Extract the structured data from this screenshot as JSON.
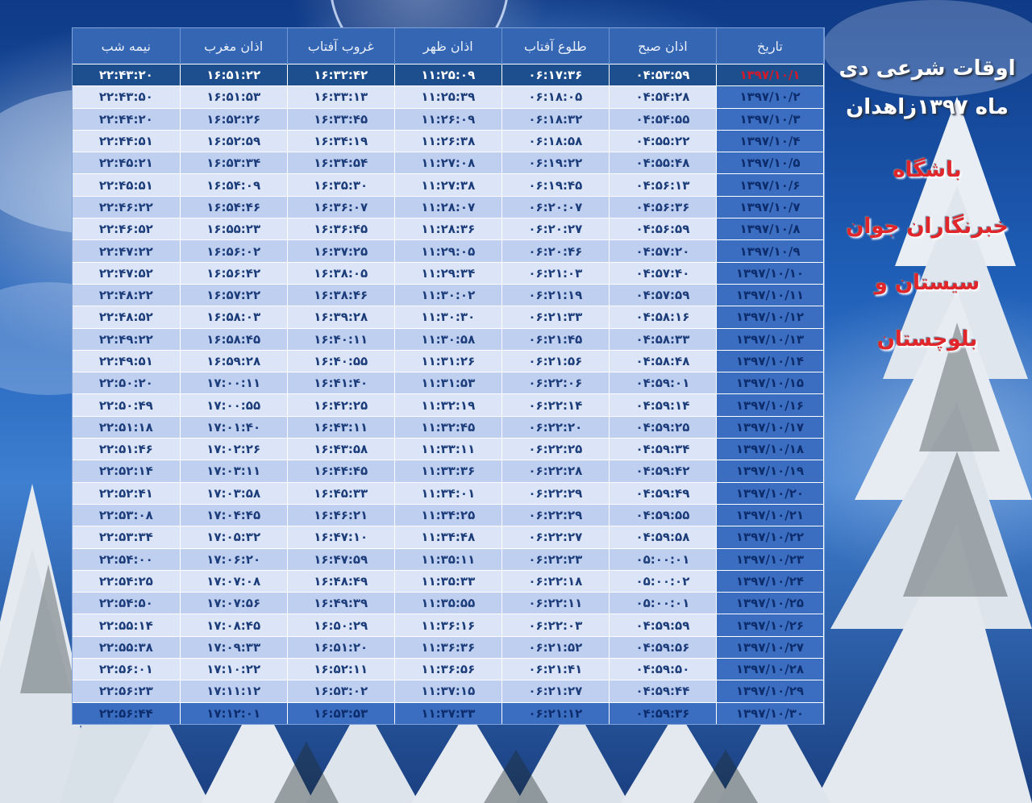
{
  "headers": [
    "تاریخ",
    "اذان صبح",
    "طلوع آفتاب",
    "اذان ظهر",
    "غروب آفتاب",
    "اذان مغرب",
    "نیمه شب"
  ],
  "rows": [
    [
      "۱۳۹۷/۱۰/۱",
      "۰۴:۵۳:۵۹",
      "۰۶:۱۷:۳۶",
      "۱۱:۲۵:۰۹",
      "۱۶:۳۲:۴۲",
      "۱۶:۵۱:۲۲",
      "۲۲:۴۳:۲۰"
    ],
    [
      "۱۳۹۷/۱۰/۲",
      "۰۴:۵۴:۲۸",
      "۰۶:۱۸:۰۵",
      "۱۱:۲۵:۳۹",
      "۱۶:۳۳:۱۳",
      "۱۶:۵۱:۵۳",
      "۲۲:۴۳:۵۰"
    ],
    [
      "۱۳۹۷/۱۰/۳",
      "۰۴:۵۴:۵۵",
      "۰۶:۱۸:۳۲",
      "۱۱:۲۶:۰۹",
      "۱۶:۳۳:۴۵",
      "۱۶:۵۲:۲۶",
      "۲۲:۴۴:۲۰"
    ],
    [
      "۱۳۹۷/۱۰/۴",
      "۰۴:۵۵:۲۲",
      "۰۶:۱۸:۵۸",
      "۱۱:۲۶:۳۸",
      "۱۶:۳۴:۱۹",
      "۱۶:۵۲:۵۹",
      "۲۲:۴۴:۵۱"
    ],
    [
      "۱۳۹۷/۱۰/۵",
      "۰۴:۵۵:۴۸",
      "۰۶:۱۹:۲۲",
      "۱۱:۲۷:۰۸",
      "۱۶:۳۴:۵۴",
      "۱۶:۵۳:۳۴",
      "۲۲:۴۵:۲۱"
    ],
    [
      "۱۳۹۷/۱۰/۶",
      "۰۴:۵۶:۱۳",
      "۰۶:۱۹:۴۵",
      "۱۱:۲۷:۳۸",
      "۱۶:۳۵:۳۰",
      "۱۶:۵۴:۰۹",
      "۲۲:۴۵:۵۱"
    ],
    [
      "۱۳۹۷/۱۰/۷",
      "۰۴:۵۶:۳۶",
      "۰۶:۲۰:۰۷",
      "۱۱:۲۸:۰۷",
      "۱۶:۳۶:۰۷",
      "۱۶:۵۴:۴۶",
      "۲۲:۴۶:۲۲"
    ],
    [
      "۱۳۹۷/۱۰/۸",
      "۰۴:۵۶:۵۹",
      "۰۶:۲۰:۲۷",
      "۱۱:۲۸:۳۶",
      "۱۶:۳۶:۴۵",
      "۱۶:۵۵:۲۳",
      "۲۲:۴۶:۵۲"
    ],
    [
      "۱۳۹۷/۱۰/۹",
      "۰۴:۵۷:۲۰",
      "۰۶:۲۰:۴۶",
      "۱۱:۲۹:۰۵",
      "۱۶:۳۷:۲۵",
      "۱۶:۵۶:۰۲",
      "۲۲:۴۷:۲۲"
    ],
    [
      "۱۳۹۷/۱۰/۱۰",
      "۰۴:۵۷:۴۰",
      "۰۶:۲۱:۰۳",
      "۱۱:۲۹:۳۴",
      "۱۶:۳۸:۰۵",
      "۱۶:۵۶:۴۲",
      "۲۲:۴۷:۵۲"
    ],
    [
      "۱۳۹۷/۱۰/۱۱",
      "۰۴:۵۷:۵۹",
      "۰۶:۲۱:۱۹",
      "۱۱:۳۰:۰۲",
      "۱۶:۳۸:۴۶",
      "۱۶:۵۷:۲۲",
      "۲۲:۴۸:۲۲"
    ],
    [
      "۱۳۹۷/۱۰/۱۲",
      "۰۴:۵۸:۱۶",
      "۰۶:۲۱:۳۳",
      "۱۱:۳۰:۳۰",
      "۱۶:۳۹:۲۸",
      "۱۶:۵۸:۰۳",
      "۲۲:۴۸:۵۲"
    ],
    [
      "۱۳۹۷/۱۰/۱۳",
      "۰۴:۵۸:۳۳",
      "۰۶:۲۱:۴۵",
      "۱۱:۳۰:۵۸",
      "۱۶:۴۰:۱۱",
      "۱۶:۵۸:۴۵",
      "۲۲:۴۹:۲۲"
    ],
    [
      "۱۳۹۷/۱۰/۱۴",
      "۰۴:۵۸:۴۸",
      "۰۶:۲۱:۵۶",
      "۱۱:۳۱:۲۶",
      "۱۶:۴۰:۵۵",
      "۱۶:۵۹:۲۸",
      "۲۲:۴۹:۵۱"
    ],
    [
      "۱۳۹۷/۱۰/۱۵",
      "۰۴:۵۹:۰۱",
      "۰۶:۲۲:۰۶",
      "۱۱:۳۱:۵۳",
      "۱۶:۴۱:۴۰",
      "۱۷:۰۰:۱۱",
      "۲۲:۵۰:۲۰"
    ],
    [
      "۱۳۹۷/۱۰/۱۶",
      "۰۴:۵۹:۱۴",
      "۰۶:۲۲:۱۴",
      "۱۱:۳۲:۱۹",
      "۱۶:۴۲:۲۵",
      "۱۷:۰۰:۵۵",
      "۲۲:۵۰:۴۹"
    ],
    [
      "۱۳۹۷/۱۰/۱۷",
      "۰۴:۵۹:۲۵",
      "۰۶:۲۲:۲۰",
      "۱۱:۳۲:۴۵",
      "۱۶:۴۳:۱۱",
      "۱۷:۰۱:۴۰",
      "۲۲:۵۱:۱۸"
    ],
    [
      "۱۳۹۷/۱۰/۱۸",
      "۰۴:۵۹:۳۴",
      "۰۶:۲۲:۲۵",
      "۱۱:۳۳:۱۱",
      "۱۶:۴۳:۵۸",
      "۱۷:۰۲:۲۶",
      "۲۲:۵۱:۴۶"
    ],
    [
      "۱۳۹۷/۱۰/۱۹",
      "۰۴:۵۹:۴۲",
      "۰۶:۲۲:۲۸",
      "۱۱:۳۳:۳۶",
      "۱۶:۴۴:۴۵",
      "۱۷:۰۳:۱۱",
      "۲۲:۵۲:۱۴"
    ],
    [
      "۱۳۹۷/۱۰/۲۰",
      "۰۴:۵۹:۴۹",
      "۰۶:۲۲:۲۹",
      "۱۱:۳۴:۰۱",
      "۱۶:۴۵:۳۳",
      "۱۷:۰۳:۵۸",
      "۲۲:۵۲:۴۱"
    ],
    [
      "۱۳۹۷/۱۰/۲۱",
      "۰۴:۵۹:۵۵",
      "۰۶:۲۲:۲۹",
      "۱۱:۳۴:۲۵",
      "۱۶:۴۶:۲۱",
      "۱۷:۰۴:۴۵",
      "۲۲:۵۳:۰۸"
    ],
    [
      "۱۳۹۷/۱۰/۲۲",
      "۰۴:۵۹:۵۸",
      "۰۶:۲۲:۲۷",
      "۱۱:۳۴:۴۸",
      "۱۶:۴۷:۱۰",
      "۱۷:۰۵:۳۲",
      "۲۲:۵۳:۳۴"
    ],
    [
      "۱۳۹۷/۱۰/۲۳",
      "۰۵:۰۰:۰۱",
      "۰۶:۲۲:۲۳",
      "۱۱:۳۵:۱۱",
      "۱۶:۴۷:۵۹",
      "۱۷:۰۶:۲۰",
      "۲۲:۵۴:۰۰"
    ],
    [
      "۱۳۹۷/۱۰/۲۴",
      "۰۵:۰۰:۰۲",
      "۰۶:۲۲:۱۸",
      "۱۱:۳۵:۳۳",
      "۱۶:۴۸:۴۹",
      "۱۷:۰۷:۰۸",
      "۲۲:۵۴:۲۵"
    ],
    [
      "۱۳۹۷/۱۰/۲۵",
      "۰۵:۰۰:۰۱",
      "۰۶:۲۲:۱۱",
      "۱۱:۳۵:۵۵",
      "۱۶:۴۹:۳۹",
      "۱۷:۰۷:۵۶",
      "۲۲:۵۴:۵۰"
    ],
    [
      "۱۳۹۷/۱۰/۲۶",
      "۰۴:۵۹:۵۹",
      "۰۶:۲۲:۰۳",
      "۱۱:۳۶:۱۶",
      "۱۶:۵۰:۲۹",
      "۱۷:۰۸:۴۵",
      "۲۲:۵۵:۱۴"
    ],
    [
      "۱۳۹۷/۱۰/۲۷",
      "۰۴:۵۹:۵۶",
      "۰۶:۲۱:۵۲",
      "۱۱:۳۶:۳۶",
      "۱۶:۵۱:۲۰",
      "۱۷:۰۹:۳۳",
      "۲۲:۵۵:۳۸"
    ],
    [
      "۱۳۹۷/۱۰/۲۸",
      "۰۴:۵۹:۵۰",
      "۰۶:۲۱:۴۱",
      "۱۱:۳۶:۵۶",
      "۱۶:۵۲:۱۱",
      "۱۷:۱۰:۲۲",
      "۲۲:۵۶:۰۱"
    ],
    [
      "۱۳۹۷/۱۰/۲۹",
      "۰۴:۵۹:۴۴",
      "۰۶:۲۱:۲۷",
      "۱۱:۳۷:۱۵",
      "۱۶:۵۳:۰۲",
      "۱۷:۱۱:۱۲",
      "۲۲:۵۶:۲۳"
    ],
    [
      "۱۳۹۷/۱۰/۳۰",
      "۰۴:۵۹:۳۶",
      "۰۶:۲۱:۱۲",
      "۱۱:۳۷:۳۳",
      "۱۶:۵۳:۵۳",
      "۱۷:۱۲:۰۱",
      "۲۲:۵۶:۴۴"
    ]
  ],
  "side": {
    "title_line1": "اوقات شرعی دی",
    "title_line2": "ماه ۱۳۹۷زاهدان",
    "club_line1": "باشگاه",
    "club_line2": "خبرنگاران جوان",
    "club_line3": "سیستان و",
    "club_line4": "بلوچستان"
  },
  "colors": {
    "header_bg": "#3566b4",
    "row_light": "#dbe5f7",
    "row_mid": "#bfcff0",
    "date_col": "#3b6dc0",
    "highlight_row": "#1d4e8e",
    "highlight_date_text": "#d21a2a",
    "club_text": "#e0262a"
  }
}
